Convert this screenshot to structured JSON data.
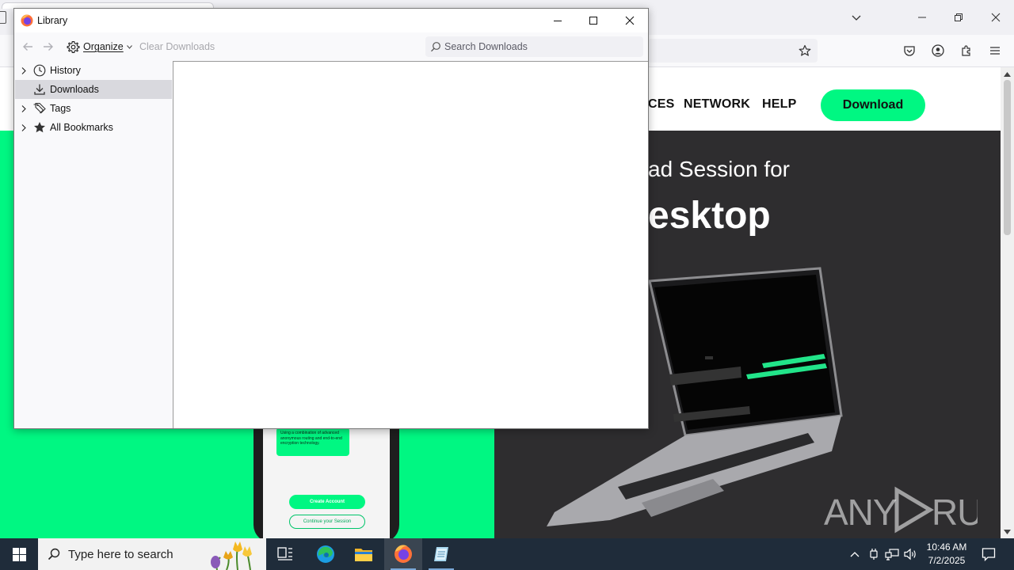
{
  "colors": {
    "site_accent": "#00f782",
    "site_dark": "#2e2d2f",
    "taskbar_bg": "#1f2c3a",
    "selected_row": "#d9d9de"
  },
  "library": {
    "title": "Library",
    "toolbar": {
      "back_icon": "back-arrow-icon",
      "forward_icon": "forward-arrow-icon",
      "organize_label": "Organize",
      "clear_label": "Clear Downloads",
      "search_placeholder": "Search Downloads",
      "search_value": ""
    },
    "sidebar": {
      "items": [
        {
          "label": "History",
          "icon": "clock-icon",
          "expandable": true,
          "selected": false
        },
        {
          "label": "Downloads",
          "icon": "download-icon",
          "expandable": false,
          "selected": true
        },
        {
          "label": "Tags",
          "icon": "tag-icon",
          "expandable": true,
          "selected": false
        },
        {
          "label": "All Bookmarks",
          "icon": "star-icon",
          "expandable": true,
          "selected": false
        }
      ]
    }
  },
  "website": {
    "nav": [
      "CES",
      "NETWORK",
      "HELP"
    ],
    "download_button": "Download",
    "hero_line1": "ad Session for",
    "hero_line2": "esktop",
    "phone": {
      "bubble_text": "Using a combination of advanced anonymous routing and end-to-end encryption technology.",
      "create_account": "Create Account",
      "continue_session": "Continue your Session"
    },
    "watermark": "ANY RUN"
  },
  "taskbar": {
    "search_placeholder": "Type here to search",
    "time": "10:46 AM",
    "date": "7/2/2025"
  }
}
